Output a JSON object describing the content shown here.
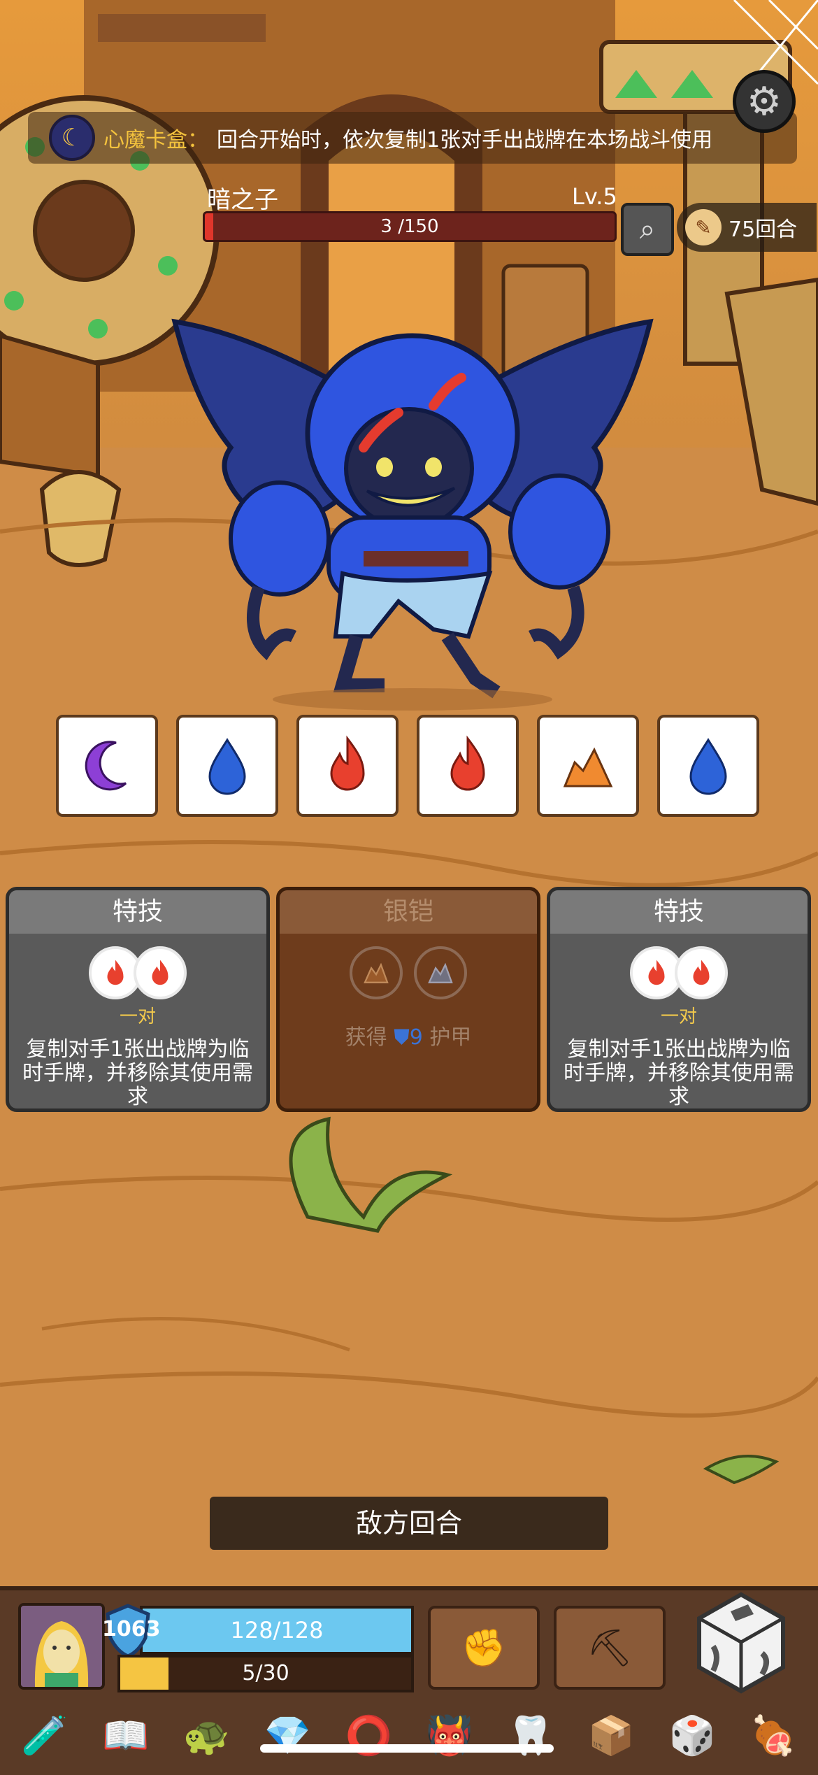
{
  "relic": {
    "icon": "crescent-moon-icon",
    "name": "心魔卡盒",
    "separator": "：",
    "description": "回合开始时，依次复制1张对手出战牌在本场战斗使用"
  },
  "enemy": {
    "name": "暗之子",
    "level": "Lv.5",
    "hp_text": "3 /150",
    "hp_fraction": 0.02
  },
  "round": {
    "label": "75回合"
  },
  "enemy_dice": [
    "moon",
    "water",
    "fire",
    "fire",
    "earth",
    "water"
  ],
  "cards": [
    {
      "title": "特技",
      "slots": [
        "fire",
        "fire"
      ],
      "combo": "一对",
      "desc": "复制对手1张出战牌为临时手牌，并移除其使用需求",
      "state": "active"
    },
    {
      "title": "银铠",
      "slots": [
        "earth",
        "earth"
      ],
      "desc_prefix": "获得",
      "armor_value": "9",
      "desc_suffix": "护甲",
      "state": "disabled"
    },
    {
      "title": "特技",
      "slots": [
        "fire",
        "fire"
      ],
      "combo": "一对",
      "desc": "复制对手1张出战牌为临时手牌，并移除其使用需求",
      "state": "active"
    }
  ],
  "turn_banner": "敌方回合",
  "player": {
    "shield": "1063",
    "hp_text": "128/128",
    "energy_text": "5/30",
    "energy_fraction": 0.167
  },
  "skills": [
    "fist-icon",
    "shovel-icon"
  ],
  "items": [
    "potion-icon",
    "skull-book-icon",
    "turtle-shell-icon",
    "emerald-icon",
    "iron-ring-icon",
    "fanged-helmet-icon",
    "fang-jaw-icon",
    "toaster-icon",
    "d20-icon",
    "meat-leg-icon"
  ],
  "colors": {
    "fire": "#e8402e",
    "water": "#2d63d8",
    "moon": "#8d3fd6",
    "earth": "#f08a30",
    "gold": "#f4c33d",
    "armor": "#3b73d6"
  }
}
